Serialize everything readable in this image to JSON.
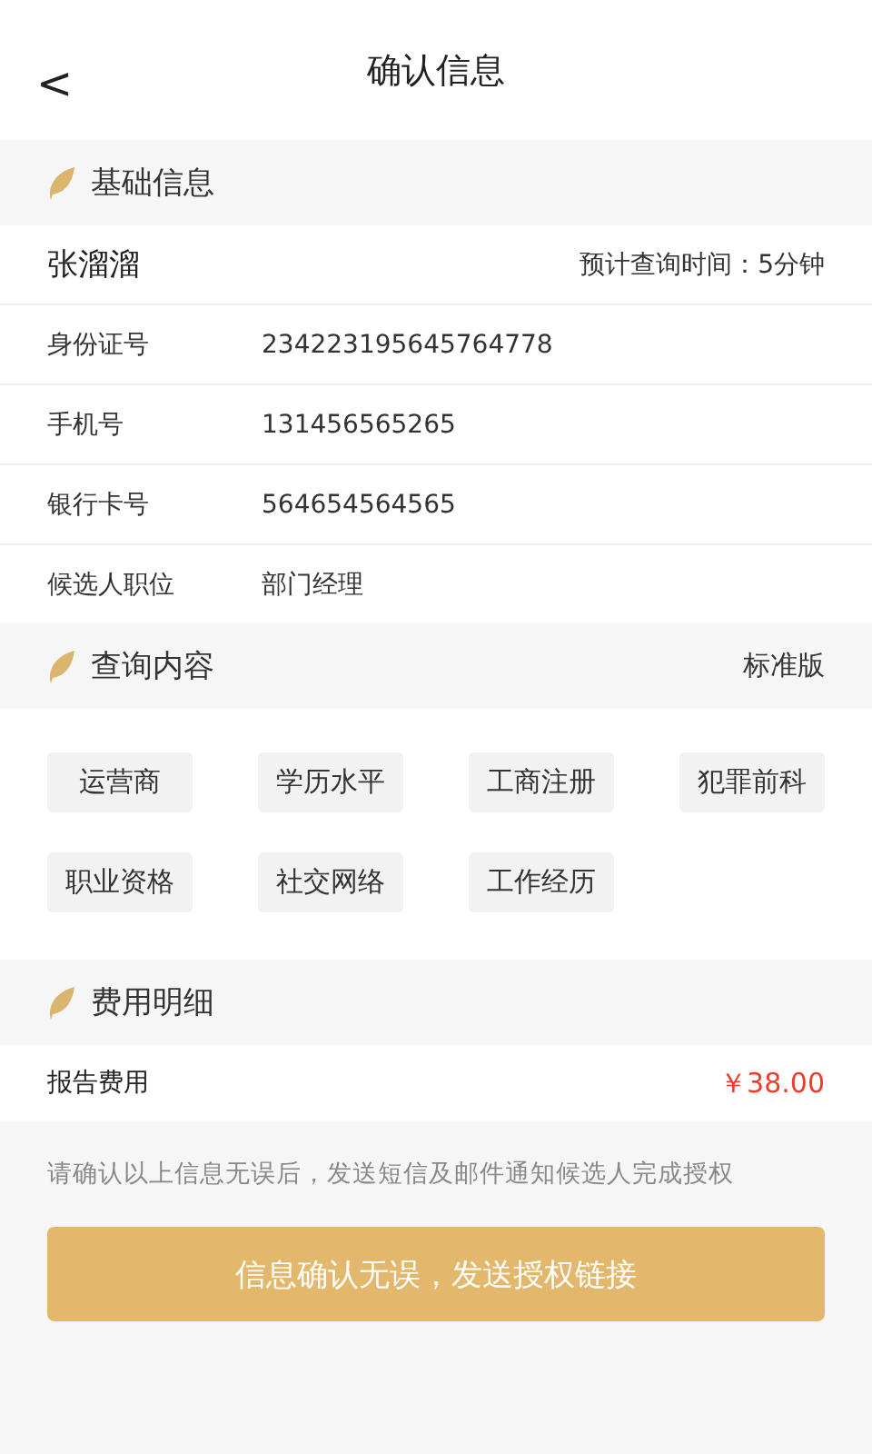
{
  "nav": {
    "back": "<",
    "title": "确认信息"
  },
  "basic": {
    "title": "基础信息",
    "name": "张溜溜",
    "eta": "预计查询时间：5分钟",
    "rows": [
      {
        "label": "身份证号",
        "value": "234223195645764778"
      },
      {
        "label": "手机号",
        "value": "131456565265"
      },
      {
        "label": "银行卡号",
        "value": "564654564565"
      },
      {
        "label": "候选人职位",
        "value": "部门经理"
      }
    ]
  },
  "query": {
    "title": "查询内容",
    "edition": "标准版",
    "tags": [
      "运营商",
      "学历水平",
      "工商注册",
      "犯罪前科",
      "职业资格",
      "社交网络",
      "工作经历"
    ]
  },
  "fees": {
    "title": "费用明细",
    "items": [
      {
        "label": "报告费用",
        "amount": "￥38.00"
      }
    ]
  },
  "note": "请确认以上信息无误后，发送短信及邮件通知候选人完成授权",
  "confirm_button": "信息确认无误，发送授权链接"
}
